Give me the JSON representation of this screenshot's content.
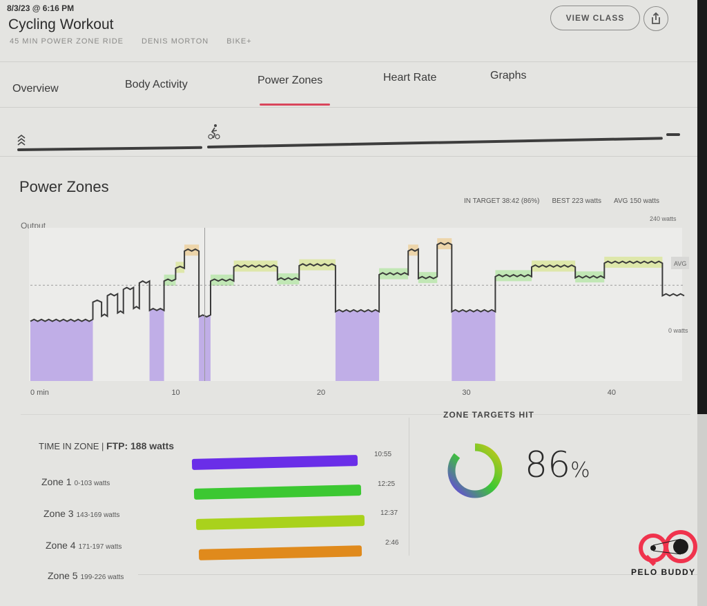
{
  "header": {
    "date": "8/3/23 @ 6:16 PM",
    "title": "Cycling Workout",
    "meta": [
      "45 MIN POWER ZONE RIDE",
      "DENIS MORTON",
      "BIKE+"
    ],
    "view_class_label": "VIEW CLASS",
    "share_icon": "share-icon"
  },
  "tabs": [
    {
      "label": "Overview",
      "active": false
    },
    {
      "label": "Body Activity",
      "active": false
    },
    {
      "label": "Power Zones",
      "active": true
    },
    {
      "label": "Heart Rate",
      "active": false
    },
    {
      "label": "Graphs",
      "active": false
    }
  ],
  "accent_color": "#d9455b",
  "progress_track": {
    "icons": [
      "chevrons-up-icon",
      "cyclist-icon"
    ]
  },
  "power_zones": {
    "title": "Power Zones",
    "stats": {
      "in_target": "IN TARGET 38:42 (86%)",
      "best": "BEST 223 watts",
      "avg": "AVG 150 watts"
    },
    "output_label": "Output",
    "y_max_label": "240 watts",
    "y_min_label": "0 watts",
    "avg_label": "AVG"
  },
  "chart_data": {
    "type": "line",
    "title": "Output",
    "xlabel": "min",
    "ylabel": "watts",
    "xlim": [
      0,
      45
    ],
    "ylim": [
      0,
      240
    ],
    "x_ticks": [
      0,
      10,
      20,
      30,
      40
    ],
    "x_tick_labels": [
      "0 min",
      "10",
      "20",
      "30",
      "40"
    ],
    "avg": 150,
    "segments": [
      {
        "start": 0,
        "end": 4.3,
        "watts": 95,
        "zone": 1
      },
      {
        "start": 4.3,
        "end": 4.9,
        "watts": 125,
        "zone": 0
      },
      {
        "start": 4.9,
        "end": 5.3,
        "watts": 103,
        "zone": 0
      },
      {
        "start": 5.3,
        "end": 6.0,
        "watts": 135,
        "zone": 0
      },
      {
        "start": 6.0,
        "end": 6.4,
        "watts": 108,
        "zone": 0
      },
      {
        "start": 6.4,
        "end": 7.1,
        "watts": 145,
        "zone": 0
      },
      {
        "start": 7.1,
        "end": 7.5,
        "watts": 115,
        "zone": 0
      },
      {
        "start": 7.5,
        "end": 8.2,
        "watts": 155,
        "zone": 0
      },
      {
        "start": 8.2,
        "end": 9.2,
        "watts": 112,
        "zone": 1
      },
      {
        "start": 9.2,
        "end": 10.0,
        "watts": 158,
        "zone": 3
      },
      {
        "start": 10.0,
        "end": 10.6,
        "watts": 178,
        "zone": 4
      },
      {
        "start": 10.6,
        "end": 11.6,
        "watts": 205,
        "zone": 5
      },
      {
        "start": 11.6,
        "end": 12.4,
        "watts": 102,
        "zone": 1
      },
      {
        "start": 12.4,
        "end": 14.0,
        "watts": 158,
        "zone": 3
      },
      {
        "start": 14.0,
        "end": 17.0,
        "watts": 180,
        "zone": 4
      },
      {
        "start": 17.0,
        "end": 18.5,
        "watts": 160,
        "zone": 3
      },
      {
        "start": 18.5,
        "end": 21.0,
        "watts": 182,
        "zone": 4
      },
      {
        "start": 21.0,
        "end": 24.0,
        "watts": 110,
        "zone": 1
      },
      {
        "start": 24.0,
        "end": 26.0,
        "watts": 168,
        "zone": 3
      },
      {
        "start": 26.0,
        "end": 26.7,
        "watts": 205,
        "zone": 5
      },
      {
        "start": 26.7,
        "end": 28.0,
        "watts": 162,
        "zone": 3
      },
      {
        "start": 28.0,
        "end": 29.0,
        "watts": 215,
        "zone": 5
      },
      {
        "start": 29.0,
        "end": 32.0,
        "watts": 110,
        "zone": 1
      },
      {
        "start": 32.0,
        "end": 34.5,
        "watts": 165,
        "zone": 3
      },
      {
        "start": 34.5,
        "end": 37.5,
        "watts": 180,
        "zone": 4
      },
      {
        "start": 37.5,
        "end": 39.5,
        "watts": 163,
        "zone": 3
      },
      {
        "start": 39.5,
        "end": 43.5,
        "watts": 186,
        "zone": 4
      },
      {
        "start": 43.5,
        "end": 45,
        "watts": 135,
        "zone": 0
      }
    ],
    "zone_colors": {
      "1": "#b9a3e6",
      "3": "#b6e6a8",
      "4": "#dbe69a",
      "5": "#eed09a"
    }
  },
  "time_in_zone": {
    "title": "TIME IN ZONE",
    "ftp": "FTP: 188 watts",
    "zones": [
      {
        "name": "Zone 1",
        "range": "0-103 watts",
        "time": "10:55",
        "fraction": 1.0,
        "color": "#6a2ee8"
      },
      {
        "name": "Zone 3",
        "range": "143-169 watts",
        "time": "12:25",
        "fraction": 1.0,
        "color": "#3cc832"
      },
      {
        "name": "Zone 4",
        "range": "171-197 watts",
        "time": "12:37",
        "fraction": 1.0,
        "color": "#a9d21c"
      },
      {
        "name": "Zone 5",
        "range": "199-226 watts",
        "time": "2:46",
        "fraction": 1.0,
        "color": "#e08a1c"
      }
    ]
  },
  "zone_targets": {
    "title": "ZONE TARGETS HIT",
    "percent": 86,
    "percent_number": "86",
    "percent_sign": "%"
  },
  "watermark": {
    "text": "PELO BUDDY",
    "color": "#f0334d"
  }
}
